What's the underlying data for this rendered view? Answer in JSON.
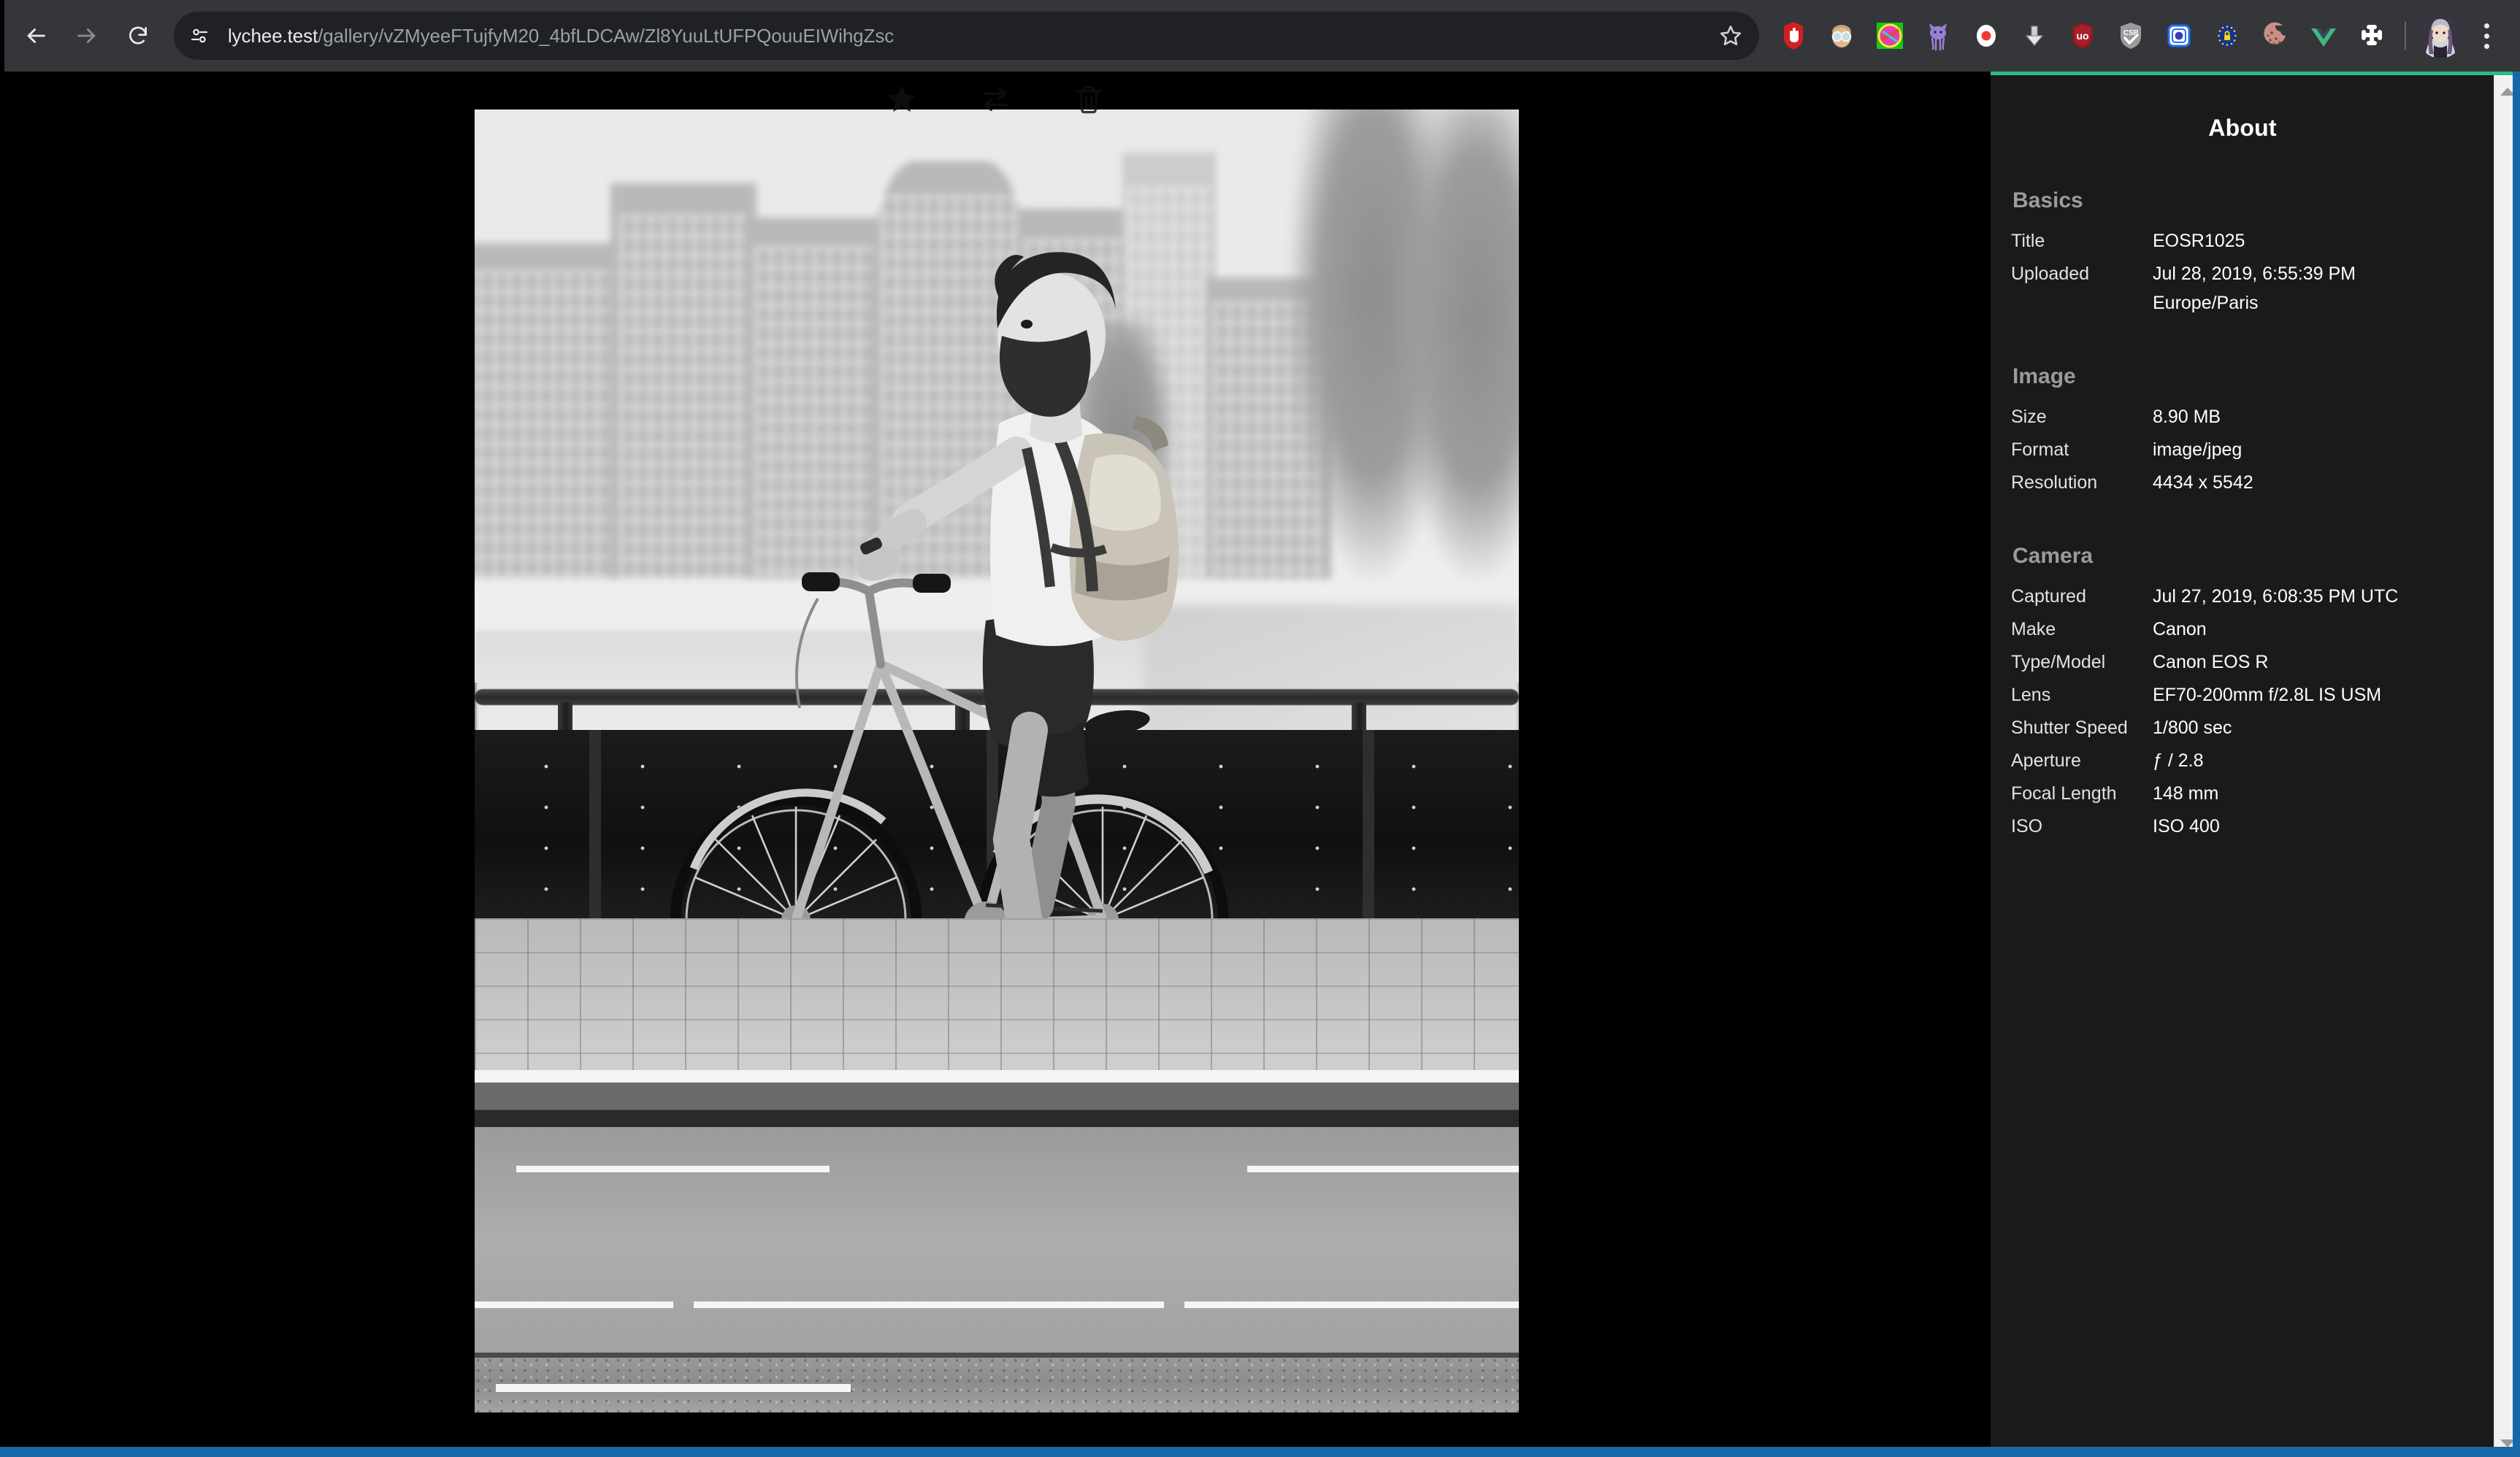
{
  "browser": {
    "back_label": "Back",
    "forward_label": "Forward",
    "reload_label": "Reload",
    "site_settings_label": "View site information",
    "url_host": "lychee.test",
    "url_path": "/gallery/vZMyeeFTujfyM20_4bfLDCAw/Zl8YuuLtUFPQouuEIWihgZsc",
    "bookmark_label": "Bookmark this tab",
    "extensions_label": "Extensions",
    "profile_label": "Profile",
    "menu_label": "Customize and control Google Chrome",
    "extensions": [
      {
        "name": "adblock-icon",
        "title": "AdBlock"
      },
      {
        "name": "face-privacy-icon",
        "title": "Privacy Badger"
      },
      {
        "name": "colorful-shield-icon",
        "title": "Extension"
      },
      {
        "name": "purple-cat-icon",
        "title": "Octotree"
      },
      {
        "name": "screen-recorder-icon",
        "title": "Screen Recorder"
      },
      {
        "name": "download-icon",
        "title": "Video Downloader"
      },
      {
        "name": "ublock-origin-icon",
        "title": "uBlock Origin"
      },
      {
        "name": "csp-shield-icon",
        "title": "CSP Evaluator"
      },
      {
        "name": "blue-square-icon",
        "title": "Extension"
      },
      {
        "name": "gdpr-badge-icon",
        "title": "GDPR / Consent"
      },
      {
        "name": "cookie-icon",
        "title": "Cookie Manager"
      },
      {
        "name": "vue-devtools-icon",
        "title": "Vue.js devtools"
      },
      {
        "name": "puzzle-piece-icon",
        "title": "Extensions"
      }
    ]
  },
  "photo_toolbar": {
    "star_label": "Star",
    "move_label": "Move",
    "delete_label": "Delete"
  },
  "photo": {
    "alt": "Black and white photo of a bearded man with a backpack riding a bicycle across a bridge beside a canal"
  },
  "sidebar": {
    "title": "About",
    "sections": [
      {
        "heading": "Basics",
        "rows": [
          {
            "key": "Title",
            "value": "EOSR1025"
          },
          {
            "key": "Uploaded",
            "value": "Jul 28, 2019, 6:55:39 PM\nEurope/Paris"
          }
        ]
      },
      {
        "heading": "Image",
        "rows": [
          {
            "key": "Size",
            "value": "8.90 MB"
          },
          {
            "key": "Format",
            "value": "image/jpeg"
          },
          {
            "key": "Resolution",
            "value": "4434 x 5542"
          }
        ]
      },
      {
        "heading": "Camera",
        "rows": [
          {
            "key": "Captured",
            "value": "Jul 27, 2019, 6:08:35 PM UTC"
          },
          {
            "key": "Make",
            "value": "Canon"
          },
          {
            "key": "Type/Model",
            "value": "Canon EOS R"
          },
          {
            "key": "Lens",
            "value": "EF70-200mm f/2.8L IS USM"
          },
          {
            "key": "Shutter Speed",
            "value": "1/800 sec"
          },
          {
            "key": "Aperture",
            "value": "ƒ / 2.8"
          },
          {
            "key": "Focal Length",
            "value": "148 mm"
          },
          {
            "key": "ISO",
            "value": "ISO 400"
          }
        ]
      }
    ]
  },
  "colors": {
    "chrome_bg": "#35363a",
    "omnibox_bg": "#202124",
    "page_bg": "#000000",
    "sidebar_bg": "#1a1a1a",
    "accent_green": "#21c08a",
    "window_edge_blue": "#1668a8",
    "url_host_text": "#e8eaed",
    "url_path_text": "#9aa0a6"
  }
}
